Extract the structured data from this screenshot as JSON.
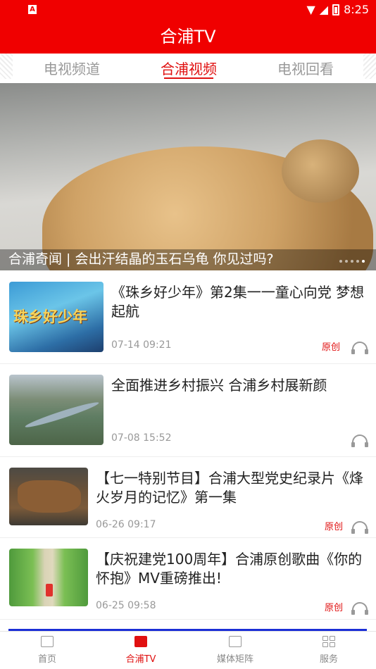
{
  "status": {
    "time": "8:25",
    "notif_icon": "A"
  },
  "appbar": {
    "title": "合浦TV"
  },
  "tabs": [
    {
      "label": "电视频道"
    },
    {
      "label": "合浦视频"
    },
    {
      "label": "电视回看"
    }
  ],
  "banner": {
    "title": "合浦奇闻 | 会出汗结晶的玉石乌龟 你见过吗?"
  },
  "news": [
    {
      "title": "《珠乡好少年》第2集一一童心向党 梦想起航",
      "time": "07-14 09:21",
      "badge": "原创",
      "thumb_text": "珠乡好少年"
    },
    {
      "title": "全面推进乡村振兴 合浦乡村展新颜",
      "time": "07-08 15:52",
      "badge": ""
    },
    {
      "title": "【七一特别节目】合浦大型党史纪录片《烽火岁月的记忆》第一集",
      "time": "06-26 09:17",
      "badge": "原创"
    },
    {
      "title": "【庆祝建党100周年】合浦原创歌曲《你的怀抱》MV重磅推出!",
      "time": "06-25 09:58",
      "badge": "原创"
    }
  ],
  "bottom_nav": [
    {
      "label": "首页",
      "icon": "news-icon"
    },
    {
      "label": "合浦TV",
      "icon": "tv-book-icon"
    },
    {
      "label": "媒体矩阵",
      "icon": "book-icon"
    },
    {
      "label": "服务",
      "icon": "grid-icon"
    }
  ],
  "colors": {
    "primary": "#f00000",
    "accent": "#e01010",
    "muted": "#999999"
  }
}
